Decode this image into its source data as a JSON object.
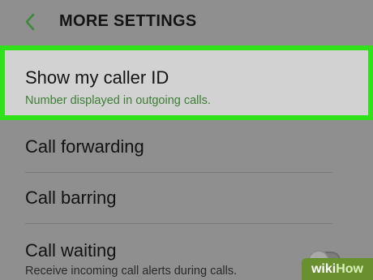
{
  "header": {
    "title": "MORE SETTINGS",
    "back_icon": "chevron-left-icon",
    "back_color": "#3f8a3a"
  },
  "items": [
    {
      "label": "Show my caller ID",
      "subtitle": "Number displayed in outgoing calls.",
      "highlighted": true
    },
    {
      "label": "Call forwarding"
    },
    {
      "label": "Call barring"
    },
    {
      "label": "Call waiting",
      "subtitle": "Receive incoming call alerts during calls.",
      "toggle": "off"
    }
  ],
  "colors": {
    "highlight_border": "#31e21b",
    "highlight_bg": "#d2d2d2",
    "subtitle_green": "#3e7d36",
    "screen_bg": "#8f8f8f"
  },
  "watermark": {
    "part1": "wiki",
    "part2": "How"
  }
}
